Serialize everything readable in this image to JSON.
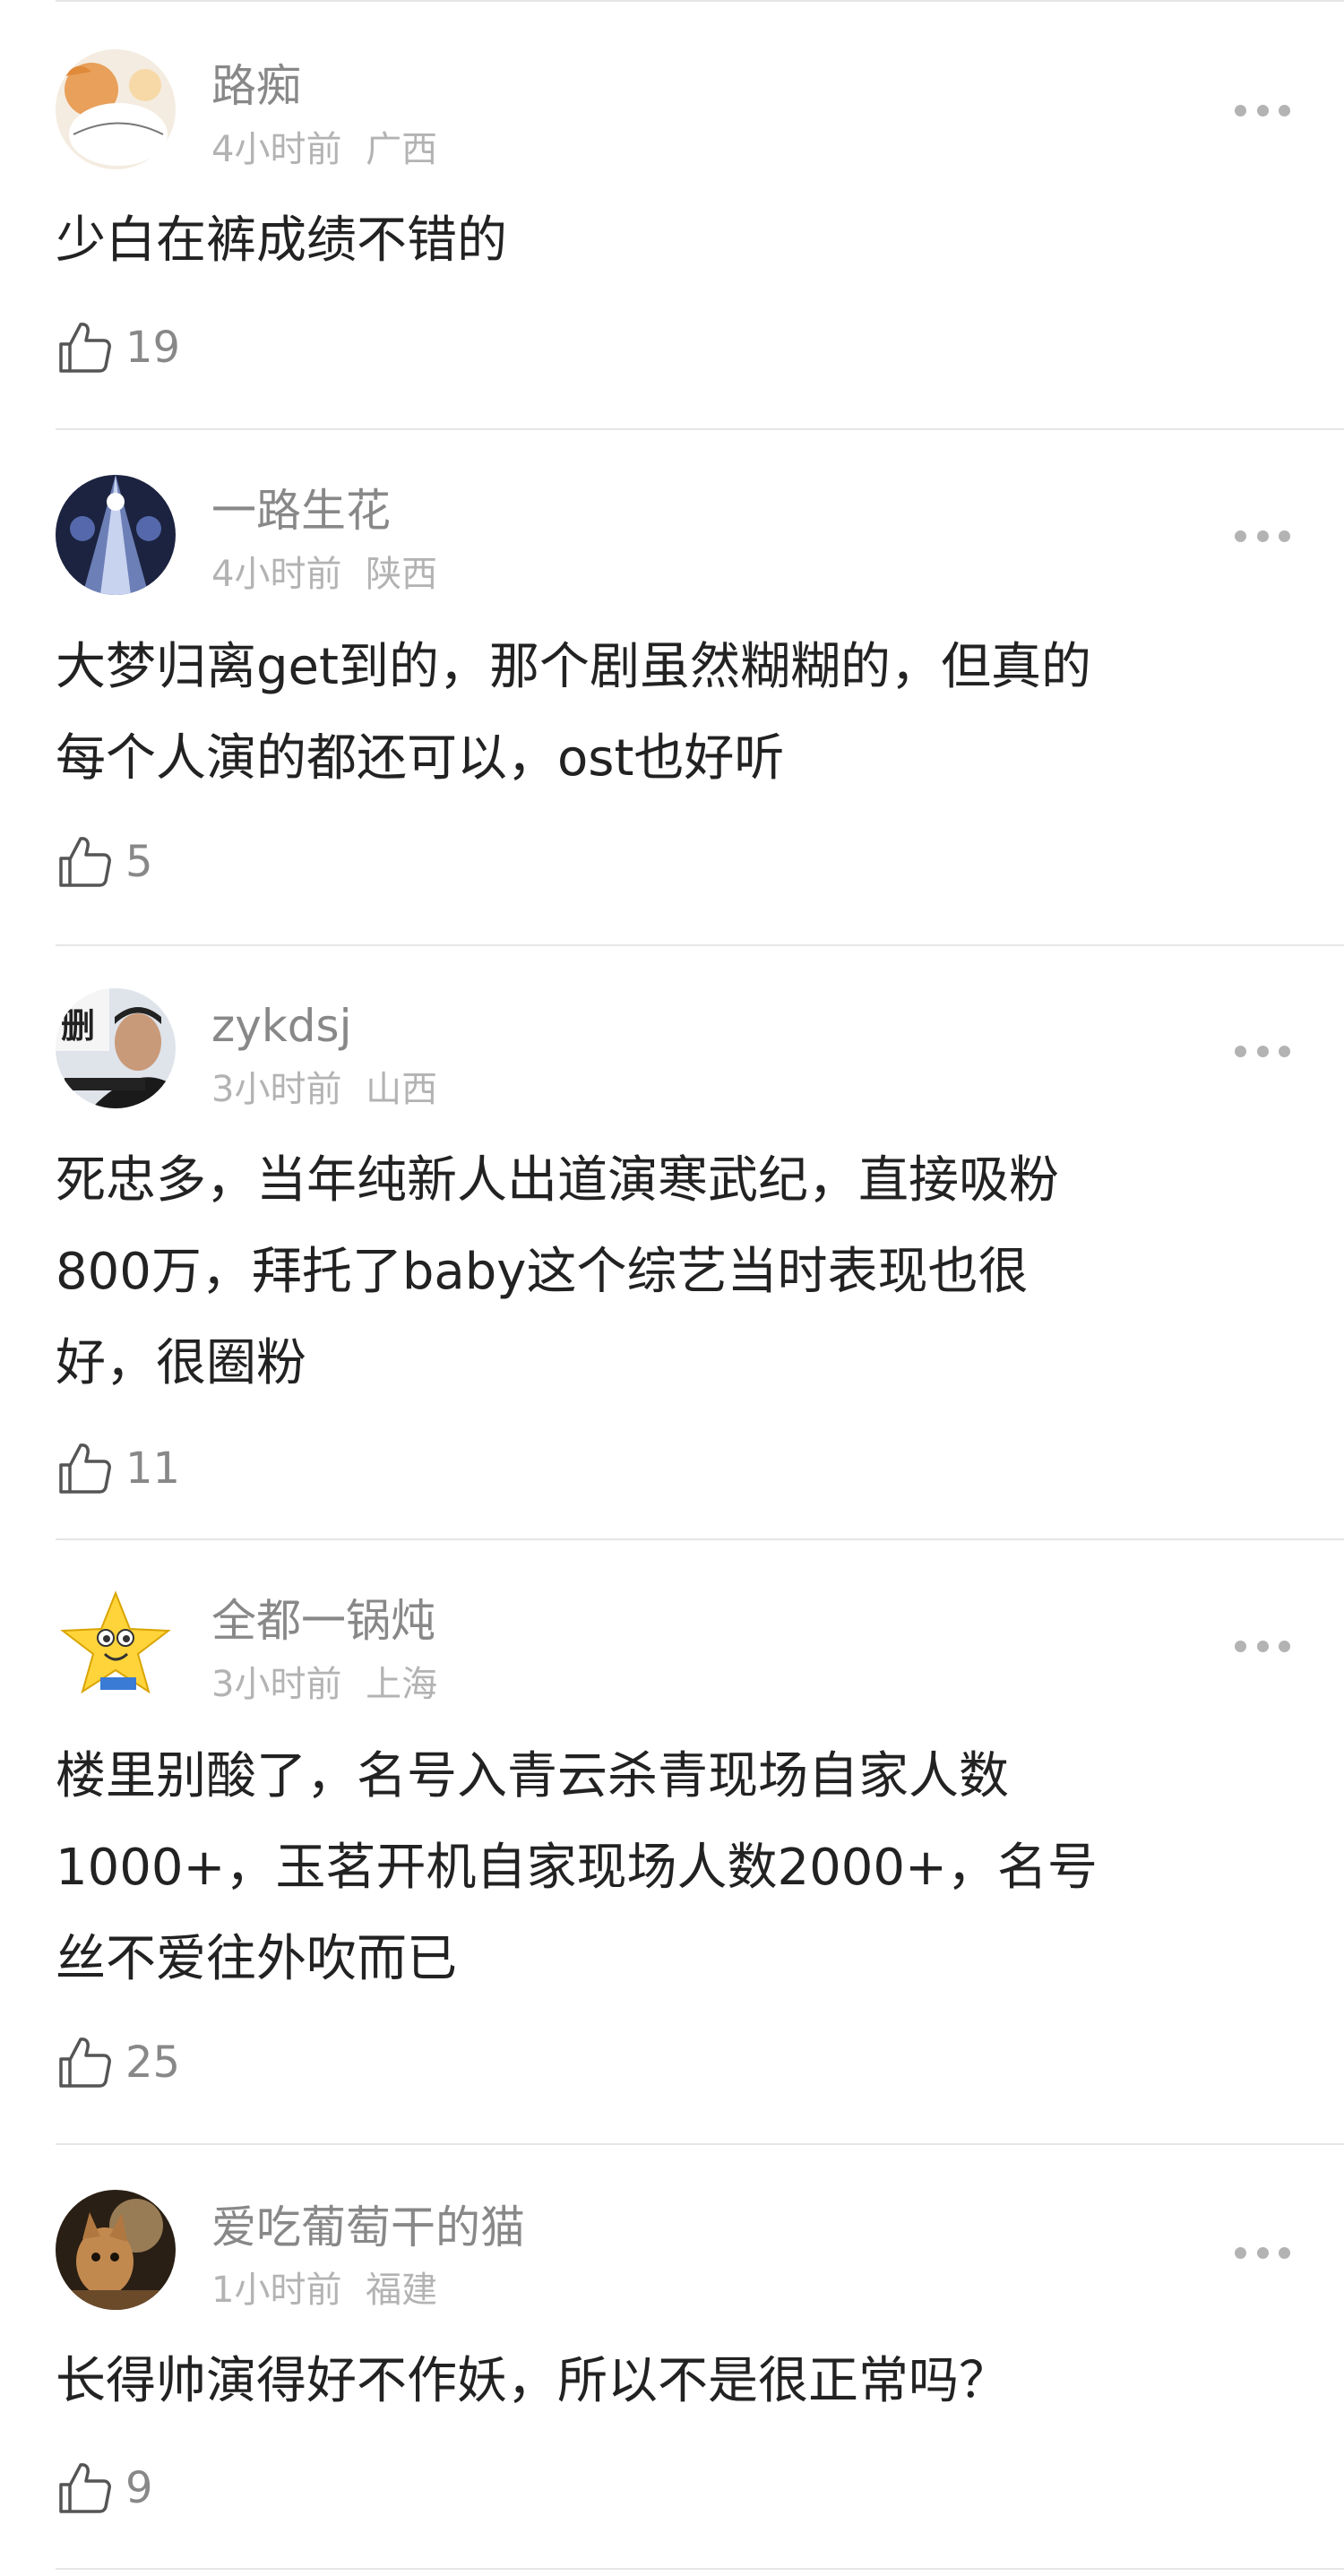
{
  "comments": [
    {
      "username": "路痴",
      "time": "4小时前",
      "location": "广西",
      "lines": [
        "少白在裤成绩不错的"
      ],
      "likes": "19",
      "avatar_icon": "cat-avatar"
    },
    {
      "username": "一路生花",
      "time": "4小时前",
      "location": "陕西",
      "lines": [
        "大梦归离get到的，那个剧虽然糊糊的，但真的",
        "每个人演的都还可以，ost也好听"
      ],
      "likes": "5",
      "avatar_icon": "stage-light-avatar"
    },
    {
      "username": "zykdsj",
      "time": "3小时前",
      "location": "山西",
      "lines": [
        "死忠多，当年纯新人出道演寒武纪，直接吸粉",
        "800万，拜托了baby这个综艺当时表现也很",
        "好，很圈粉"
      ],
      "likes": "11",
      "avatar_icon": "man-portrait-avatar"
    },
    {
      "username": "全都一锅炖",
      "time": "3小时前",
      "location": "上海",
      "lines": [
        "楼里别酸了，名号入青云杀青现场自家人数",
        "1000+，玉茗开机自家现场人数2000+，名号",
        "丝不爱往外吹而已"
      ],
      "likes": "25",
      "avatar_icon": "yellow-star-avatar"
    },
    {
      "username": "爱吃葡萄干的猫",
      "time": "1小时前",
      "location": "福建",
      "lines": [
        "长得帅演得好不作妖，所以不是很正常吗？"
      ],
      "likes": "9",
      "avatar_icon": "kitten-avatar"
    }
  ],
  "colors": {
    "username": "#888888",
    "meta": "#b3b3b3",
    "text": "#222222",
    "divider": "#e6e6e6"
  }
}
